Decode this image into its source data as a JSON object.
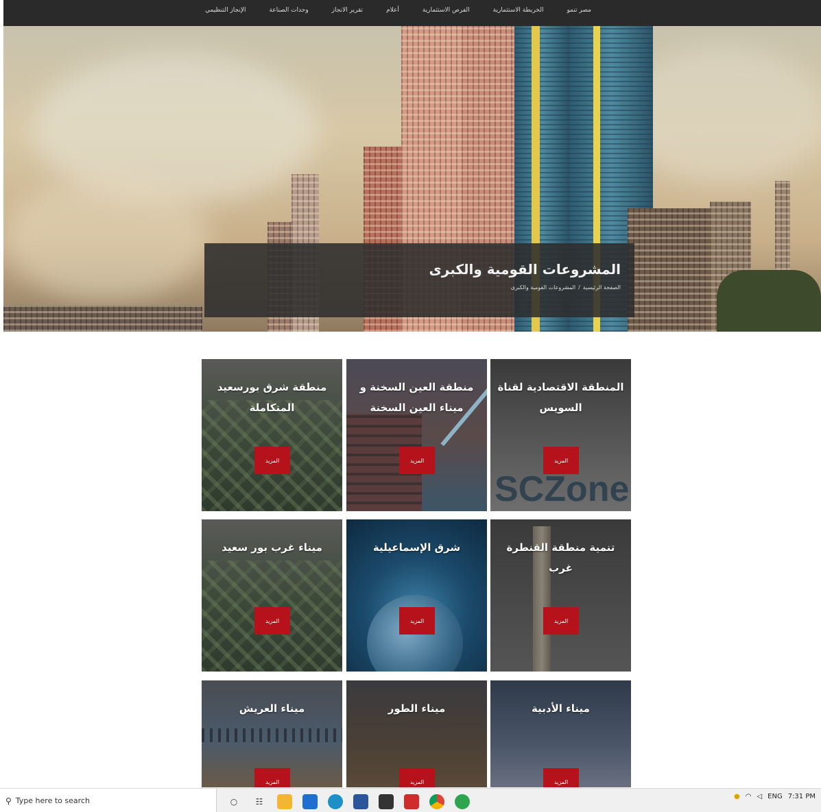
{
  "nav": {
    "items": [
      "مصر تنمو",
      "الخريطة الاستثمارية",
      "الفرص الاستثمارية",
      "أعلام",
      "تقرير الانجاز",
      "وحدات الصناعة",
      "الإنجاز التنظيمي"
    ]
  },
  "hero": {
    "title": "المشروعات القومية والكبرى",
    "breadcrumb_home": "الصفحة الرئيسية",
    "breadcrumb_sep": "/",
    "breadcrumb_current": "المشروعات القومية والكبرى"
  },
  "cards": [
    {
      "title": "المنطقة الاقتصادية لقناة السويس",
      "button": "المزيد",
      "bg_text": "SCZone"
    },
    {
      "title": "منطقة العين السخنة و ميناء العين السخنة",
      "button": "المزيد"
    },
    {
      "title": "منطقة شرق بورسعيد المتكاملة",
      "button": "المزيد"
    },
    {
      "title": "تنمية منطقة القنطرة غرب",
      "button": "المزيد"
    },
    {
      "title": "شرق الإسماعيلية",
      "button": "المزيد"
    },
    {
      "title": "ميناء غرب بور سعيد",
      "button": "المزيد"
    },
    {
      "title": "ميناء الأدبية",
      "button": "المزيد"
    },
    {
      "title": "ميناء الطور",
      "button": "المزيد"
    },
    {
      "title": "ميناء العريش",
      "button": "المزيد"
    }
  ],
  "taskbar": {
    "search_placeholder": "Type here to search",
    "clock": "7:31 PM",
    "lang": "ENG"
  },
  "colors": {
    "nav_bg": "#2a2a2a",
    "button_red": "#b5121b"
  }
}
